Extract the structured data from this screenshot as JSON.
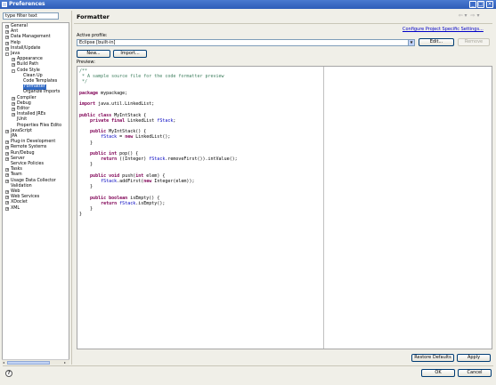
{
  "window": {
    "title": "Preferences"
  },
  "filter": {
    "value": "type filter text"
  },
  "tree": [
    {
      "label": "General",
      "expander": "+",
      "level": 0
    },
    {
      "label": "Ant",
      "expander": "+",
      "level": 0
    },
    {
      "label": "Data Management",
      "expander": "+",
      "level": 0
    },
    {
      "label": "Help",
      "expander": "+",
      "level": 0
    },
    {
      "label": "Install/Update",
      "expander": "+",
      "level": 0
    },
    {
      "label": "Java",
      "expander": "-",
      "level": 0
    },
    {
      "label": "Appearance",
      "expander": "+",
      "level": 1
    },
    {
      "label": "Build Path",
      "expander": "+",
      "level": 1
    },
    {
      "label": "Code Style",
      "expander": "-",
      "level": 1
    },
    {
      "label": "Clean Up",
      "expander": "",
      "level": 2
    },
    {
      "label": "Code Templates",
      "expander": "",
      "level": 2
    },
    {
      "label": "Formatter",
      "expander": "",
      "level": 2,
      "selected": true
    },
    {
      "label": "Organize Imports",
      "expander": "",
      "level": 2
    },
    {
      "label": "Compiler",
      "expander": "+",
      "level": 1
    },
    {
      "label": "Debug",
      "expander": "+",
      "level": 1
    },
    {
      "label": "Editor",
      "expander": "+",
      "level": 1
    },
    {
      "label": "Installed JREs",
      "expander": "+",
      "level": 1
    },
    {
      "label": "JUnit",
      "expander": "",
      "level": 1
    },
    {
      "label": "Properties Files Edito",
      "expander": "",
      "level": 1
    },
    {
      "label": "JavaScript",
      "expander": "+",
      "level": 0
    },
    {
      "label": "JPA",
      "expander": "",
      "level": 0
    },
    {
      "label": "Plug-in Development",
      "expander": "+",
      "level": 0
    },
    {
      "label": "Remote Systems",
      "expander": "+",
      "level": 0
    },
    {
      "label": "Run/Debug",
      "expander": "+",
      "level": 0
    },
    {
      "label": "Server",
      "expander": "+",
      "level": 0
    },
    {
      "label": "Service Policies",
      "expander": "",
      "level": 0
    },
    {
      "label": "Tasks",
      "expander": "+",
      "level": 0
    },
    {
      "label": "Team",
      "expander": "+",
      "level": 0
    },
    {
      "label": "Usage Data Collector",
      "expander": "+",
      "level": 0
    },
    {
      "label": "Validation",
      "expander": "",
      "level": 0
    },
    {
      "label": "Web",
      "expander": "+",
      "level": 0
    },
    {
      "label": "Web Services",
      "expander": "+",
      "level": 0
    },
    {
      "label": "XDoclet",
      "expander": "+",
      "level": 0
    },
    {
      "label": "XML",
      "expander": "+",
      "level": 0
    }
  ],
  "page": {
    "title": "Formatter",
    "configure_link": "Configure Project Specific Settings...",
    "active_profile_label": "Active profile:",
    "profile_value": "Eclipse [built-in]",
    "edit_label": "Edit...",
    "remove_label": "Remove",
    "new_label": "New...",
    "import_label": "Import...",
    "preview_label": "Preview:"
  },
  "code": [
    {
      "text": "/**",
      "style": "cm"
    },
    {
      "text": " * A sample source file for the code formatter preview",
      "style": "cm"
    },
    {
      "text": " */",
      "style": "cm"
    },
    {
      "text": "",
      "style": ""
    },
    {
      "parts": [
        {
          "t": "package",
          "c": "kw"
        },
        {
          "t": " mypackage;",
          "c": ""
        }
      ]
    },
    {
      "text": "",
      "style": ""
    },
    {
      "parts": [
        {
          "t": "import",
          "c": "kw"
        },
        {
          "t": " java.util.LinkedList;",
          "c": ""
        }
      ]
    },
    {
      "text": "",
      "style": ""
    },
    {
      "parts": [
        {
          "t": "public",
          "c": "kw"
        },
        {
          "t": " ",
          "c": ""
        },
        {
          "t": "class",
          "c": "kw"
        },
        {
          "t": " MyIntStack {",
          "c": ""
        }
      ]
    },
    {
      "parts": [
        {
          "t": "    ",
          "c": ""
        },
        {
          "t": "private",
          "c": "kw"
        },
        {
          "t": " ",
          "c": ""
        },
        {
          "t": "final",
          "c": "kw"
        },
        {
          "t": " LinkedList ",
          "c": ""
        },
        {
          "t": "fStack",
          "c": "fld"
        },
        {
          "t": ";",
          "c": ""
        }
      ]
    },
    {
      "text": "",
      "style": ""
    },
    {
      "parts": [
        {
          "t": "    ",
          "c": ""
        },
        {
          "t": "public",
          "c": "kw"
        },
        {
          "t": " MyIntStack() {",
          "c": ""
        }
      ]
    },
    {
      "parts": [
        {
          "t": "        ",
          "c": ""
        },
        {
          "t": "fStack",
          "c": "fld"
        },
        {
          "t": " = ",
          "c": ""
        },
        {
          "t": "new",
          "c": "kw"
        },
        {
          "t": " LinkedList();",
          "c": ""
        }
      ]
    },
    {
      "text": "    }",
      "style": ""
    },
    {
      "text": "",
      "style": ""
    },
    {
      "parts": [
        {
          "t": "    ",
          "c": ""
        },
        {
          "t": "public",
          "c": "kw"
        },
        {
          "t": " ",
          "c": ""
        },
        {
          "t": "int",
          "c": "kw"
        },
        {
          "t": " pop() {",
          "c": ""
        }
      ]
    },
    {
      "parts": [
        {
          "t": "        ",
          "c": ""
        },
        {
          "t": "return",
          "c": "kw"
        },
        {
          "t": " ((Integer) ",
          "c": ""
        },
        {
          "t": "fStack",
          "c": "fld"
        },
        {
          "t": ".removeFirst()).intValue();",
          "c": ""
        }
      ]
    },
    {
      "text": "    }",
      "style": ""
    },
    {
      "text": "",
      "style": ""
    },
    {
      "parts": [
        {
          "t": "    ",
          "c": ""
        },
        {
          "t": "public",
          "c": "kw"
        },
        {
          "t": " ",
          "c": ""
        },
        {
          "t": "void",
          "c": "kw"
        },
        {
          "t": " push(",
          "c": ""
        },
        {
          "t": "int",
          "c": "kw"
        },
        {
          "t": " elem) {",
          "c": ""
        }
      ]
    },
    {
      "parts": [
        {
          "t": "        ",
          "c": ""
        },
        {
          "t": "fStack",
          "c": "fld"
        },
        {
          "t": ".addFirst(",
          "c": ""
        },
        {
          "t": "new",
          "c": "kw"
        },
        {
          "t": " Integer(elem));",
          "c": ""
        }
      ]
    },
    {
      "text": "    }",
      "style": ""
    },
    {
      "text": "",
      "style": ""
    },
    {
      "parts": [
        {
          "t": "    ",
          "c": ""
        },
        {
          "t": "public",
          "c": "kw"
        },
        {
          "t": " ",
          "c": ""
        },
        {
          "t": "boolean",
          "c": "kw"
        },
        {
          "t": " isEmpty() {",
          "c": ""
        }
      ]
    },
    {
      "parts": [
        {
          "t": "        ",
          "c": ""
        },
        {
          "t": "return",
          "c": "kw"
        },
        {
          "t": " ",
          "c": ""
        },
        {
          "t": "fStack",
          "c": "fld"
        },
        {
          "t": ".isEmpty();",
          "c": ""
        }
      ]
    },
    {
      "text": "    }",
      "style": ""
    },
    {
      "text": "}",
      "style": ""
    }
  ],
  "buttons": {
    "restore_defaults": "Restore Defaults",
    "apply": "Apply",
    "ok": "OK",
    "cancel": "Cancel"
  },
  "icons": {
    "help": "?",
    "back": "⇦",
    "forward": "⇨"
  }
}
